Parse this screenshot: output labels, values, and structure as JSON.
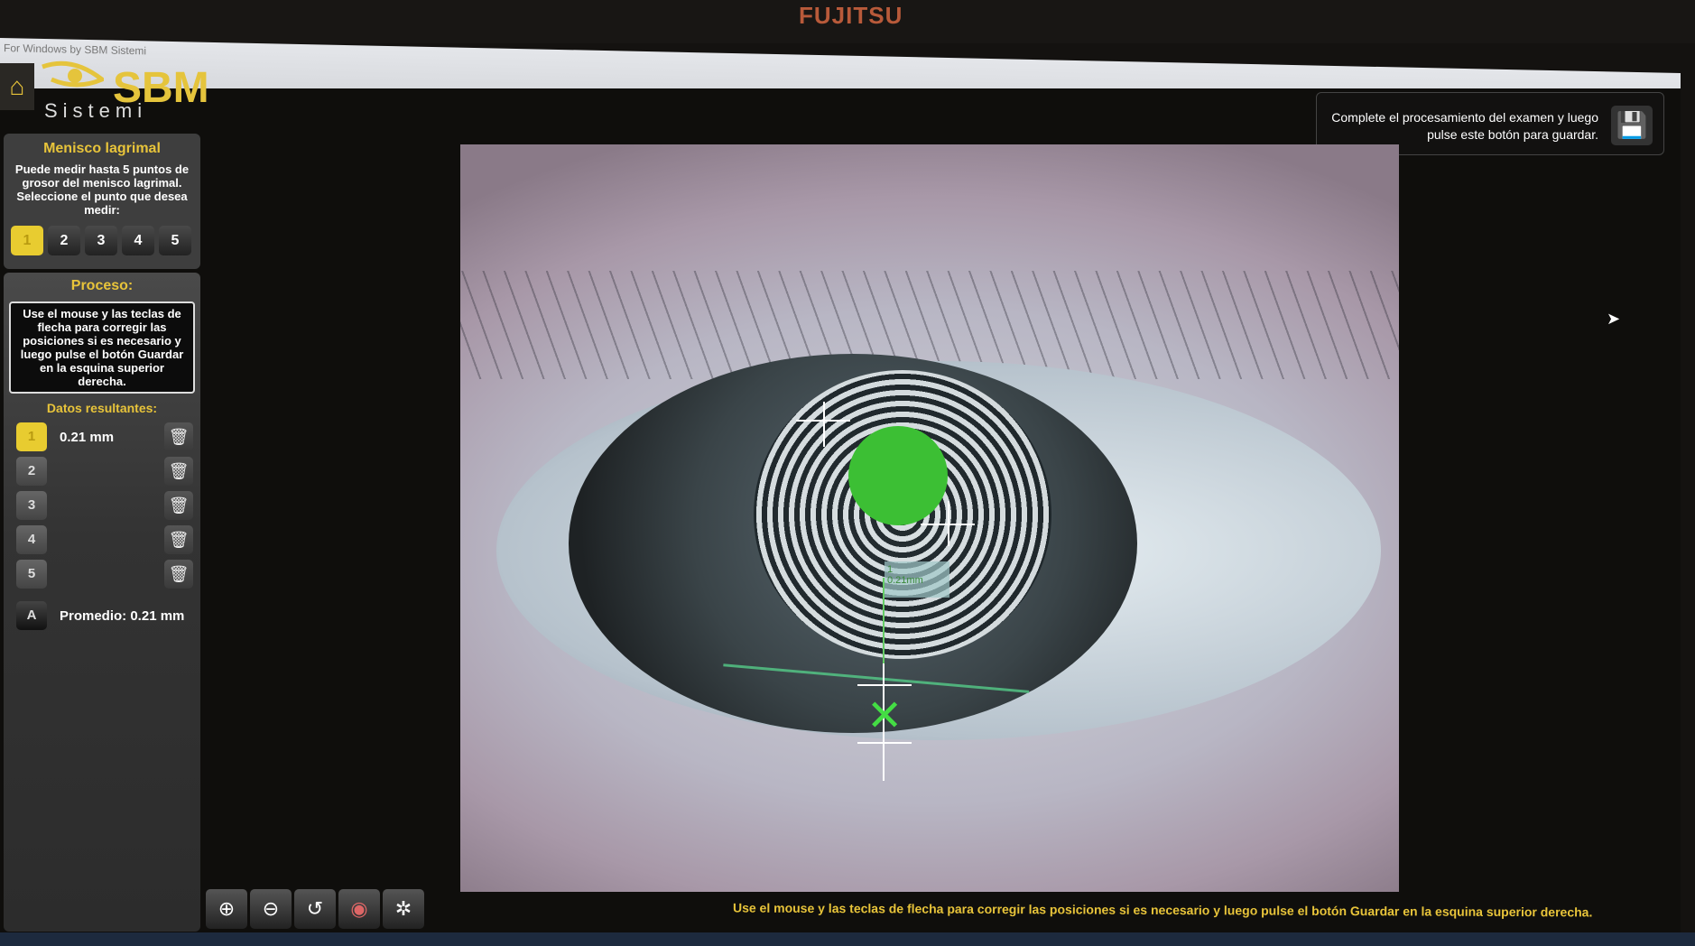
{
  "monitor_brand": "FUJITSU",
  "window": {
    "title": "For Windows by SBM Sistemi",
    "controls": [
      "–",
      "❐",
      "✕"
    ]
  },
  "logo": {
    "name": "SBM",
    "subtitle": "Sistemi"
  },
  "meniscus_panel": {
    "title": "Menisco lagrimal",
    "description": "Puede medir hasta 5 puntos de grosor del menisco lagrimal. Seleccione el punto que desea medir:",
    "points": [
      "1",
      "2",
      "3",
      "4",
      "5"
    ],
    "selected": "1"
  },
  "process_panel": {
    "title": "Proceso:",
    "instructions": "Use el mouse y las teclas de flecha para corregir las posiciones si es necesario y luego pulse el botón Guardar en la esquina superior derecha."
  },
  "results": {
    "title": "Datos resultantes:",
    "rows": [
      {
        "label": "1",
        "value": "0.21 mm"
      },
      {
        "label": "2",
        "value": ""
      },
      {
        "label": "3",
        "value": ""
      },
      {
        "label": "4",
        "value": ""
      },
      {
        "label": "5",
        "value": ""
      }
    ],
    "average_label": "A",
    "average": "Promedio: 0.21 mm"
  },
  "save": {
    "text": "Complete el procesamiento del examen y luego pulse este botón para guardar."
  },
  "image_overlay": {
    "point": "1",
    "value": "0.21mm"
  },
  "toolbar": [
    "zoom-in",
    "zoom-out",
    "reset",
    "eye-view",
    "center"
  ],
  "status_message": "Use el mouse y las teclas de flecha para corregir las posiciones si es necesario y luego pulse el botón Guardar en la esquina superior derecha.",
  "colors": {
    "accent": "#e8c43a",
    "measure": "#3cbf34"
  }
}
